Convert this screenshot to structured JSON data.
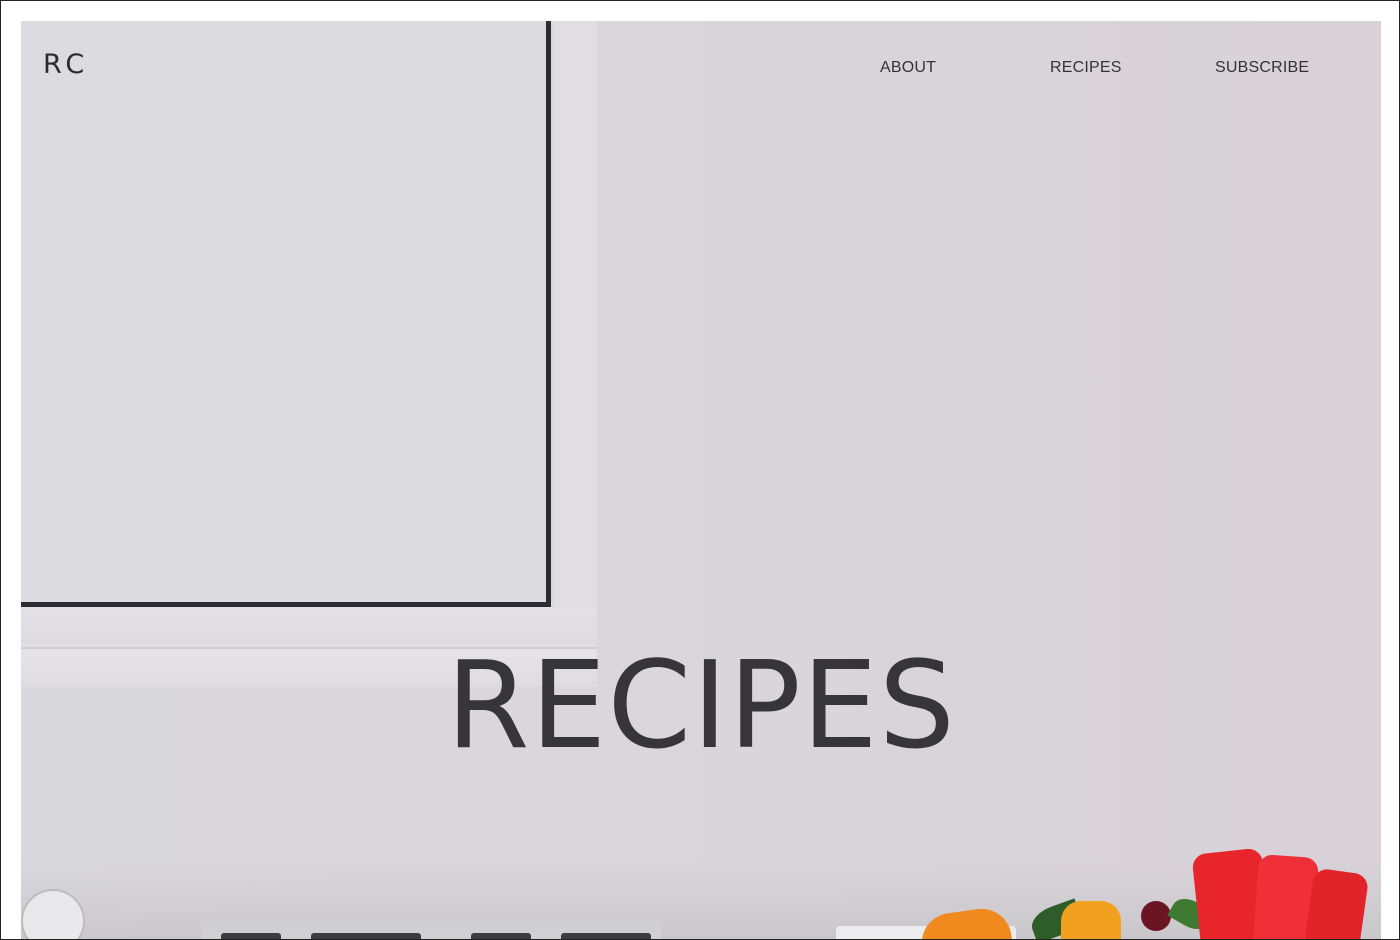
{
  "brand": {
    "logo_text": "RC"
  },
  "nav": {
    "items": [
      {
        "label": "ABOUT"
      },
      {
        "label": "RECIPES"
      },
      {
        "label": "SUBSCRIBE"
      }
    ]
  },
  "hero": {
    "title": "RECIPES"
  },
  "colors": {
    "text": "#363638",
    "background": "#d9d8dc",
    "accent_red": "#e8252b"
  }
}
